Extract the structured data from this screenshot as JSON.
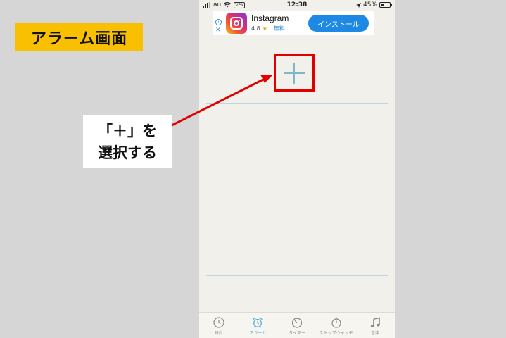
{
  "screen_label": "アラーム画面",
  "status_bar": {
    "carrier": "au",
    "vpn": "VPN",
    "time": "12:38",
    "battery": "45%",
    "battery_level": 0.45
  },
  "ad": {
    "info": "i",
    "close": "✕",
    "app_name": "Instagram",
    "rating": "4.8",
    "star": "★",
    "price": "無料",
    "install_label": "インストール"
  },
  "callout": {
    "line1": "「＋」を",
    "line2": "選択する"
  },
  "tabs": [
    {
      "label": "時計",
      "icon": "clock-icon"
    },
    {
      "label": "アラーム",
      "icon": "alarm-clock-icon"
    },
    {
      "label": "タイマー",
      "icon": "timer-icon"
    },
    {
      "label": "ストップウォッチ",
      "icon": "stopwatch-icon"
    },
    {
      "label": "音楽",
      "icon": "music-note-icon"
    }
  ],
  "colors": {
    "highlight": "#e00000",
    "label_bg": "#f8c000",
    "active_tab": "#4aa8d6",
    "plus": "#7fb7c9"
  }
}
